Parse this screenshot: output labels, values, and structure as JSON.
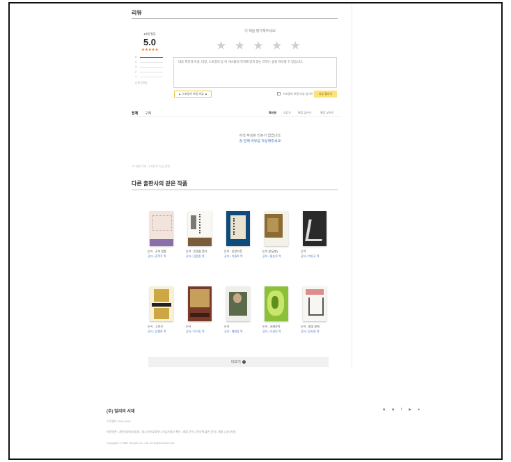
{
  "review": {
    "section_title": "리뷰",
    "avg_label": "●회원평점",
    "avg_score": "5.0",
    "avg_stars": "★★★★★",
    "distribution": [
      {
        "label": "5",
        "fraction": 1.0
      },
      {
        "label": "4",
        "fraction": 0.0
      },
      {
        "label": "3",
        "fraction": 0.0
      },
      {
        "label": "2",
        "fraction": 0.0
      },
      {
        "label": "1",
        "fraction": 0.0
      }
    ],
    "review_count": "(1명 참여)",
    "rate_prompt": "이 책을 평가해주세요!",
    "input_placeholder": "내용 폭언과 욕설, 비방, 스포일러 등 이 게시물의 목적에 맞지 않는 리뷰는 숨김 처리될 수 있습니다.",
    "spoiler_button": "▲ 스포일러 포함 리뷰 ▲",
    "spoiler_check_label": "스포일러 포함 리뷰 숨기기",
    "submit_button": "리뷰 올리기",
    "tabs": [
      {
        "label": "전체",
        "active": true
      },
      {
        "label": "구매",
        "active": false
      }
    ],
    "sort_options": [
      {
        "label": "최신순",
        "active": true
      },
      {
        "label": "공감순",
        "active": false
      },
      {
        "label": "별점 높은순",
        "active": false
      },
      {
        "label": "별점 낮은순",
        "active": false
      }
    ],
    "empty_line1": "아직 작성된 리뷰가 없습니다.",
    "empty_line2": "첫 번째 리뷰를 작성해주세요!",
    "note": "※ 리뷰 작성 시 포인트 지급 안내"
  },
  "related": {
    "section_title": "다른 출판사의 같은 작품",
    "more_button": "더보기",
    "more_icon": "plus-circle-icon",
    "books": [
      {
        "title": "논어 - 공자 말씀",
        "author": "공자 / 김학주 역"
      },
      {
        "title": "논어 - 인생을 묻다",
        "author": "공자 / 김원중 역"
      },
      {
        "title": "논어 - 동양고전",
        "author": "공자 / 이을호 역"
      },
      {
        "title": "논어 (한글판)",
        "author": "공자 / 홍승직 역"
      },
      {
        "title": "논어",
        "author": "공자 / 박성규 역"
      },
      {
        "title": "논어 - 고전선",
        "author": "공자 / 김형찬 역"
      },
      {
        "title": "논어",
        "author": "공자 / 이기동 역"
      },
      {
        "title": "논어",
        "author": "공자 / 배병삼 역"
      },
      {
        "title": "논어 - 세계문학",
        "author": "공자 / 오세진 역"
      },
      {
        "title": "논어 - 평생 곁에",
        "author": "공자 / 임자헌 역"
      }
    ]
  },
  "footer": {
    "company": "(주) 밀리의 서재",
    "line1": "고객센터 1544-6991",
    "line2": "이용약관 | 개인정보처리방침 | 청소년보호정책 | 사업자정보 확인 | 제휴 문의 | 전자책 출판 문의 | 채용 | 공지사항",
    "line3": "Copyright © Millie Seojae Co., Ltd. All Rights Reserved.",
    "social": [
      "blog-icon",
      "instagram-icon",
      "facebook-icon",
      "youtube-icon",
      "kakao-icon"
    ]
  },
  "colors": {
    "accent_star": "#f07a1e",
    "submit_bg": "#fbe37a",
    "author_link": "#4a78c2"
  }
}
